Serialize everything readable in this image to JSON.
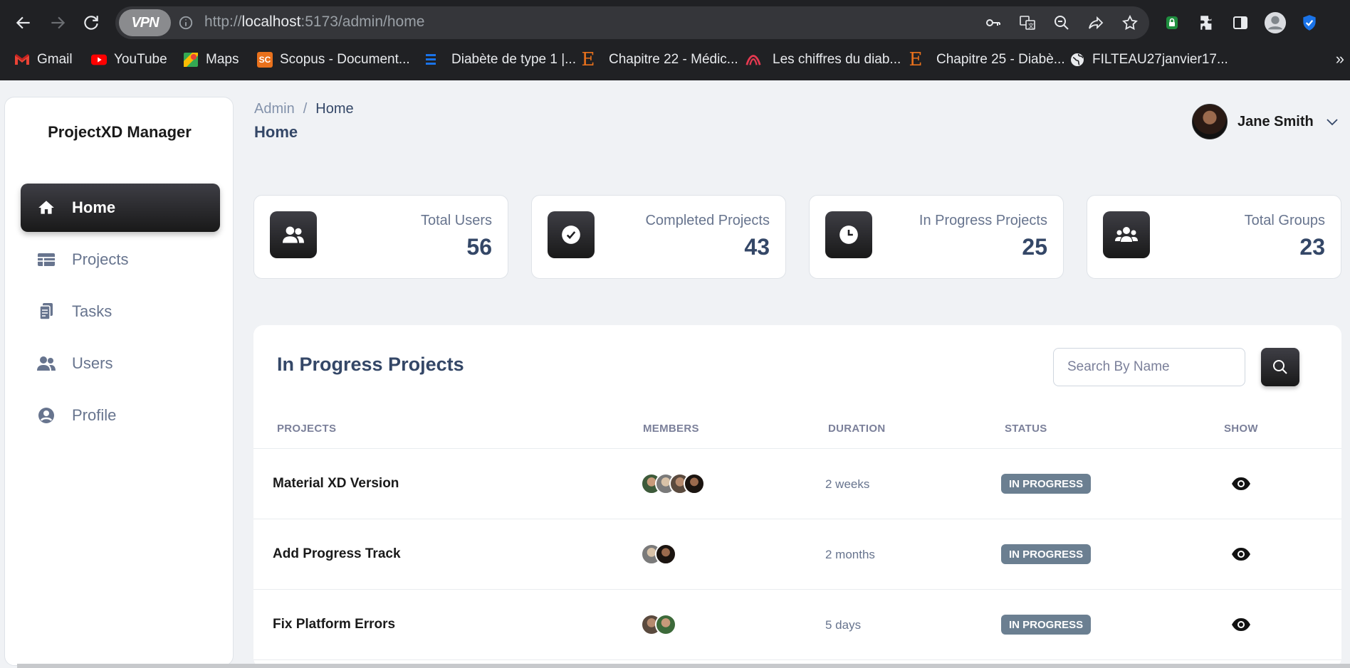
{
  "browser": {
    "vpn_label": "VPN",
    "url_scheme": "http://",
    "url_host": "localhost",
    "url_rest": ":5173/admin/home",
    "bookmarks": [
      {
        "label": "Gmail",
        "icon": "gmail-icon",
        "color": "#ea4335"
      },
      {
        "label": "YouTube",
        "icon": "youtube-icon",
        "color": "#ff0000"
      },
      {
        "label": "Maps",
        "icon": "maps-icon",
        "color": "#34a853"
      },
      {
        "label": "Scopus - Document...",
        "icon": "scopus-icon",
        "color": "#e9711c"
      },
      {
        "label": "Diabète de type 1 |...",
        "icon": "list-icon",
        "color": "#1a73e8"
      },
      {
        "label": "Chapitre 22 - Médic...",
        "icon": "elsevier-icon",
        "color": "#e9711c"
      },
      {
        "label": "Les chiffres du diab...",
        "icon": "federation-icon",
        "color": "#c2185b"
      },
      {
        "label": "Chapitre 25 - Diabè...",
        "icon": "elsevier-icon",
        "color": "#e9711c"
      },
      {
        "label": "FILTEAU27janvier17...",
        "icon": "globe-icon",
        "color": "#e8eaed"
      }
    ],
    "more": "»"
  },
  "app": {
    "brand": "ProjectXD Manager",
    "nav": [
      {
        "label": "Home",
        "icon": "home-icon",
        "active": true
      },
      {
        "label": "Projects",
        "icon": "table-icon",
        "active": false
      },
      {
        "label": "Tasks",
        "icon": "tasks-icon",
        "active": false
      },
      {
        "label": "Users",
        "icon": "users-icon",
        "active": false
      },
      {
        "label": "Profile",
        "icon": "profile-icon",
        "active": false
      }
    ],
    "breadcrumb": {
      "root": "Admin",
      "sep": "/",
      "current": "Home"
    },
    "page_title": "Home",
    "user": {
      "name": "Jane Smith"
    },
    "stats": [
      {
        "label": "Total Users",
        "value": "56",
        "icon": "users-icon"
      },
      {
        "label": "Completed Projects",
        "value": "43",
        "icon": "check-circle-icon"
      },
      {
        "label": "In Progress Projects",
        "value": "25",
        "icon": "clock-icon"
      },
      {
        "label": "Total Groups",
        "value": "23",
        "icon": "groups-icon"
      }
    ],
    "projects_table": {
      "title": "In Progress Projects",
      "search_placeholder": "Search By Name",
      "columns": [
        "PROJECTS",
        "MEMBERS",
        "DURATION",
        "STATUS",
        "SHOW"
      ],
      "rows": [
        {
          "name": "Material XD Version",
          "members": 4,
          "duration": "2 weeks",
          "status": "IN PROGRESS"
        },
        {
          "name": "Add Progress Track",
          "members": 2,
          "duration": "2 months",
          "status": "IN PROGRESS"
        },
        {
          "name": "Fix Platform Errors",
          "members": 2,
          "duration": "5 days",
          "status": "IN PROGRESS"
        }
      ]
    }
  }
}
